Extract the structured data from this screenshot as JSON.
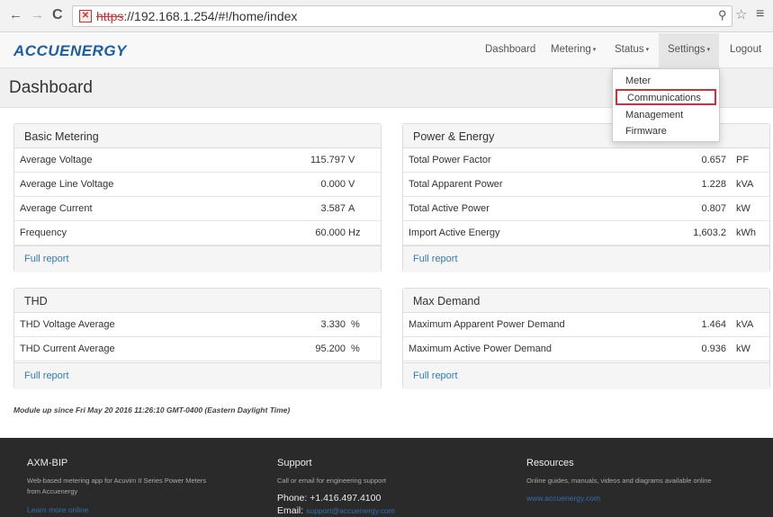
{
  "browser": {
    "url_scheme": "https",
    "url_rest": "://192.168.1.254/#!/home/index",
    "lock_glyph": "✕",
    "back_glyph": "←",
    "forward_glyph": "→",
    "reload_glyph": "C",
    "zoom_glyph": "⚲",
    "star_glyph": "☆",
    "menu_glyph": "≡"
  },
  "navbar": {
    "brand": "ACCUENERGY",
    "items": [
      {
        "label": "Dashboard"
      },
      {
        "label": "Metering"
      },
      {
        "label": "Status"
      },
      {
        "label": "Settings"
      },
      {
        "label": "Logout"
      }
    ],
    "caret": "▾"
  },
  "header": {
    "title": "Dashboard"
  },
  "settings_dropdown": {
    "items": [
      {
        "label": "Meter"
      },
      {
        "label": "Communications"
      },
      {
        "label": "Management"
      },
      {
        "label": "Firmware"
      }
    ],
    "highlighted_color": "#d0303a"
  },
  "panels": {
    "basic_metering": {
      "title": "Basic Metering",
      "rows": [
        {
          "label": "Average Voltage",
          "value": "115.797",
          "unit": "V"
        },
        {
          "label": "Average Line Voltage",
          "value": "0.000",
          "unit": "V"
        },
        {
          "label": "Average Current",
          "value": "3.587",
          "unit": "A"
        },
        {
          "label": "Frequency",
          "value": "60.000",
          "unit": "Hz"
        }
      ],
      "footer_link": "Full report"
    },
    "power_energy": {
      "title": "Power & Energy",
      "rows": [
        {
          "label": "Total Power Factor",
          "value": "0.657",
          "unit": "PF"
        },
        {
          "label": "Total Apparent Power",
          "value": "1.228",
          "unit": "kVA"
        },
        {
          "label": "Total Active Power",
          "value": "0.807",
          "unit": "kW"
        },
        {
          "label": "Import Active Energy",
          "value": "1,603.2",
          "unit": "kWh"
        }
      ],
      "footer_link": "Full report"
    },
    "thd": {
      "title": "THD",
      "rows": [
        {
          "label": "THD Voltage Average",
          "value": "3.330",
          "unit": "%"
        },
        {
          "label": "THD Current Average",
          "value": "95.200",
          "unit": "%"
        }
      ],
      "footer_link": "Full report"
    },
    "max_demand": {
      "title": "Max Demand",
      "rows": [
        {
          "label": "Maximum Apparent Power Demand",
          "value": "1.464",
          "unit": "kVA"
        },
        {
          "label": "Maximum Active Power Demand",
          "value": "0.936",
          "unit": "kW"
        }
      ],
      "footer_link": "Full report"
    }
  },
  "uptime": "Module up since Fri May 20 2016 11:26:10 GMT-0400 (Eastern Daylight Time)",
  "footer": {
    "col1": {
      "heading": "AXM-BIP",
      "line1": "Web-based metering app for Acuvim II Series Power Meters",
      "line2": "from Accuenergy",
      "link": "Learn more online"
    },
    "col2": {
      "heading": "Support",
      "line1": "Call or email for engineering support",
      "phone": "Phone: +1.416.497.4100",
      "email_label": "Email:",
      "email": "support@accuenergy.com"
    },
    "col3": {
      "heading": "Resources",
      "line1": "Online guides, manuals, videos and diagrams available online",
      "link": "www.accuenergy.com"
    }
  },
  "colors": {
    "brand": "#1a5ea8",
    "link": "#337ab7",
    "highlight_border": "#d0303a",
    "footer_bg": "#2a2a2a"
  }
}
